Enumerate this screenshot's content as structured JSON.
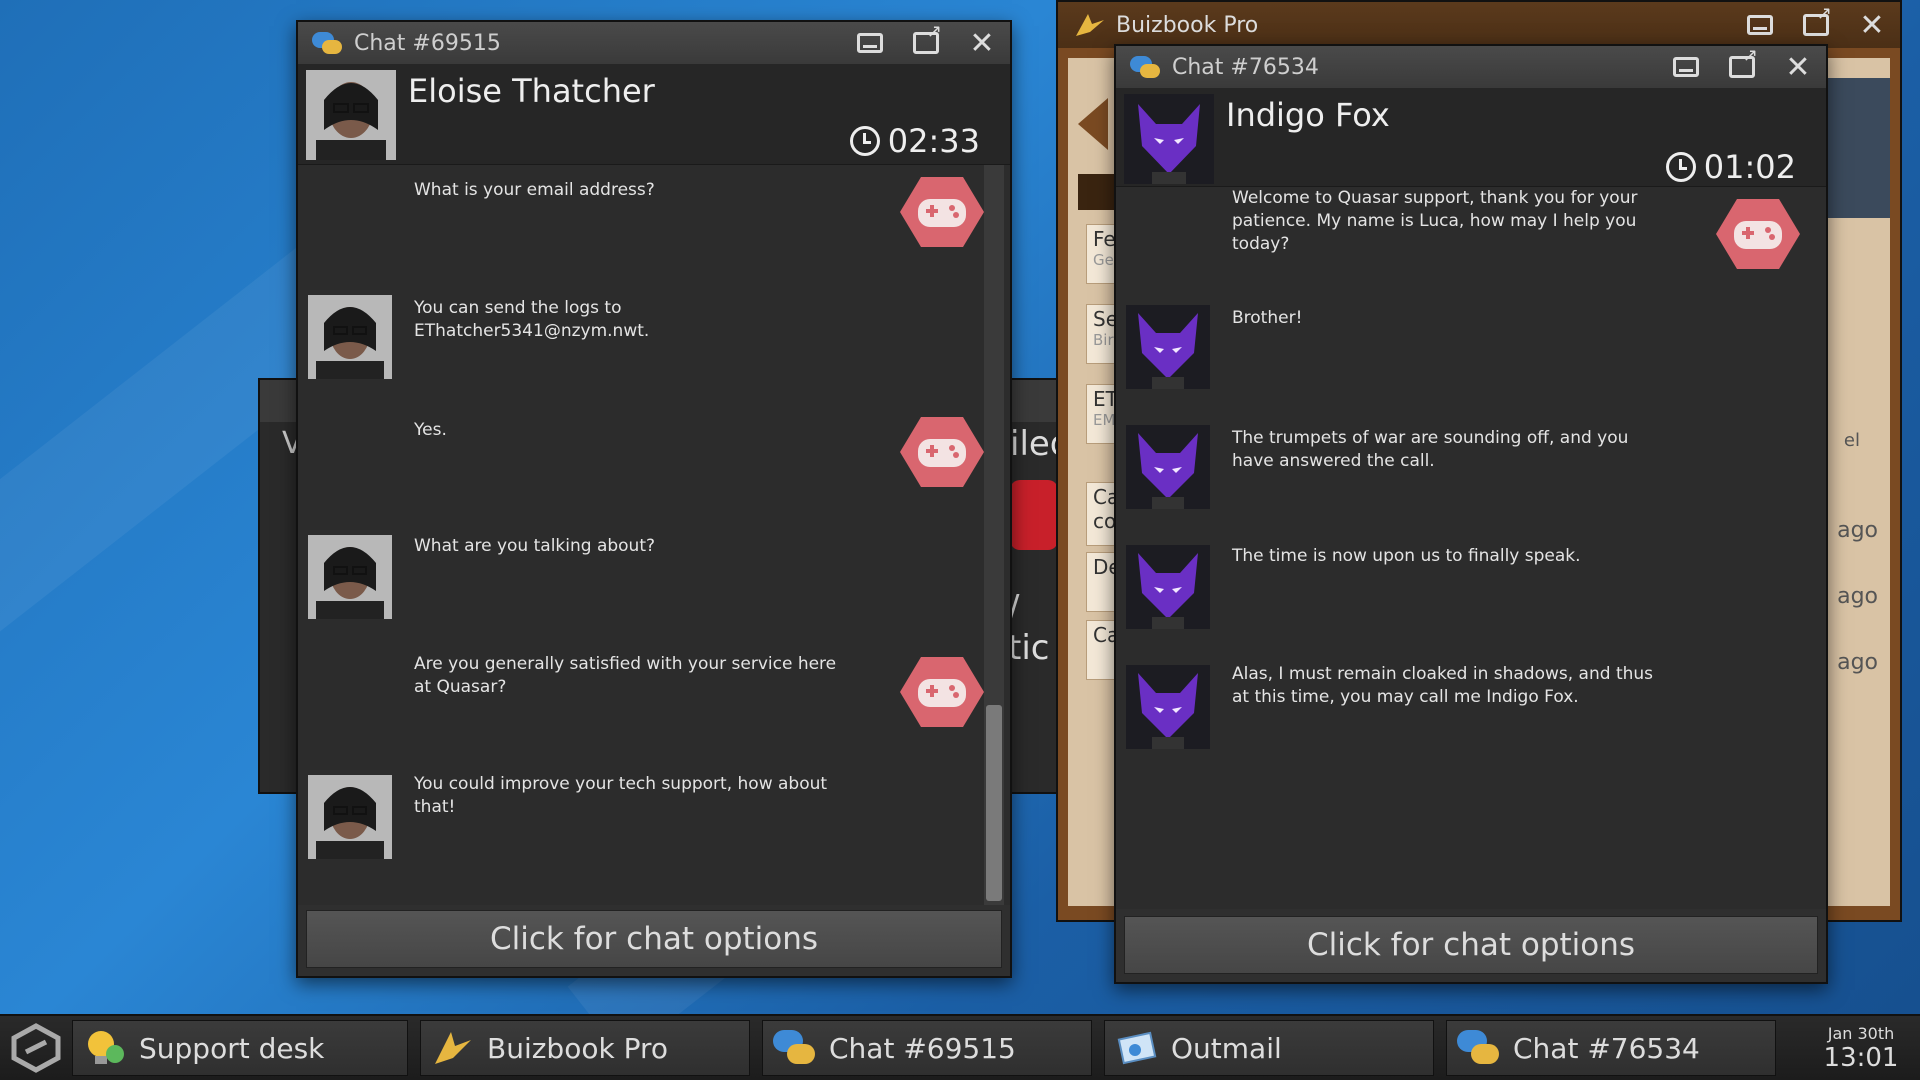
{
  "chat_left": {
    "title": "Chat #69515",
    "customer_name": "Eloise Thatcher",
    "timer": "02:33",
    "messages": [
      {
        "from": "agent",
        "text": "What is your email address?"
      },
      {
        "from": "customer",
        "text": "You can send the logs to EThatcher5341@nzym.nwt."
      },
      {
        "from": "agent",
        "text": "Yes."
      },
      {
        "from": "customer",
        "text": "What are you talking about?"
      },
      {
        "from": "agent",
        "text": "Are you generally satisfied with your service here at Quasar?"
      },
      {
        "from": "customer",
        "text": "You could improve your tech support, how about that!"
      }
    ],
    "footer": "Click for chat options"
  },
  "chat_right": {
    "title": "Chat #76534",
    "customer_name": "Indigo Fox",
    "timer": "01:02",
    "messages": [
      {
        "from": "agent",
        "text": "Welcome to Quasar support, thank you for your patience. My name is Luca, how may I help you today?"
      },
      {
        "from": "customer",
        "text": "Brother!"
      },
      {
        "from": "customer",
        "text": "The trumpets of war are sounding off, and you have answered the call."
      },
      {
        "from": "customer",
        "text": "The time is now upon us to finally speak."
      },
      {
        "from": "customer",
        "text": "Alas, I must remain cloaked in shadows, and thus at this time, you may call me Indigo Fox."
      }
    ],
    "footer": "Click for chat options"
  },
  "buizbook": {
    "title": "Buizbook Pro",
    "partial_labels": [
      "Fe",
      "Ge",
      "Se",
      "Bir",
      "ET",
      "EM",
      "Ca",
      "co",
      "De",
      "Ca"
    ],
    "ago_labels": [
      "ago",
      "ago",
      "ago"
    ],
    "partial_right": "el"
  },
  "background_window": {
    "partial_text_1": "iled",
    "partial_text_2": "/ tic",
    "partial_text_3": "V"
  },
  "taskbar": {
    "items": [
      {
        "label": "Support desk",
        "icon": "lightbulb-icon"
      },
      {
        "label": "Buizbook Pro",
        "icon": "buizbook-icon"
      },
      {
        "label": "Chat #69515",
        "icon": "chat-bubbles-icon"
      },
      {
        "label": "Outmail",
        "icon": "mail-icon"
      },
      {
        "label": "Chat #76534",
        "icon": "chat-bubbles-icon"
      }
    ],
    "date": "Jan 30th",
    "time": "13:01"
  },
  "colors": {
    "agent_icon": "#e0707a",
    "fox_purple": "#6a2fc4",
    "desktop_blue": "#2a86d4"
  }
}
